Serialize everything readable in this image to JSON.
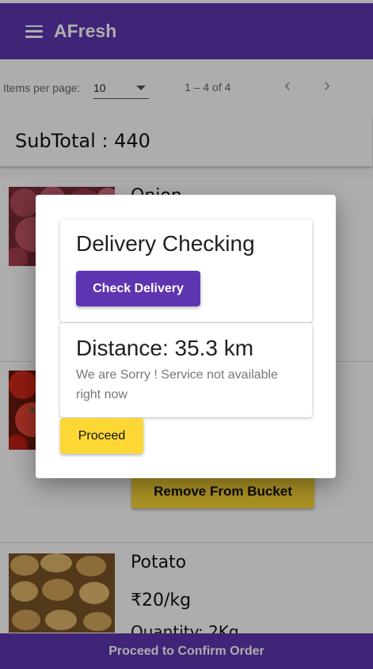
{
  "app": {
    "title": "AFresh",
    "menu_icon": "hamburger-menu-icon",
    "brand_color": "#5e35b1",
    "accent_color": "#fdd835"
  },
  "paginator": {
    "items_per_page_label": "Items per page:",
    "items_per_page_value": "10",
    "range_label": "1 – 4 of 4",
    "prev_icon": "chevron-left-icon",
    "next_icon": "chevron-right-icon"
  },
  "subtotal": {
    "label": "SubTotal : 440"
  },
  "items": [
    {
      "name": "Onion",
      "image": "onion-photo"
    },
    {
      "name": "",
      "image": "tomato-photo",
      "remove_label": "Remove From Bucket"
    },
    {
      "name": "Potato",
      "price": "₹20/kg",
      "quantity": "Quantity: 2Kg",
      "image": "potato-photo"
    }
  ],
  "footer": {
    "confirm_label": "Proceed to Confirm Order"
  },
  "dialog": {
    "title": "Delivery Checking",
    "check_button": "Check Delivery",
    "distance": "Distance: 35.3 km",
    "message": "We are Sorry ! Service not available right now",
    "proceed_button": "Proceed"
  }
}
